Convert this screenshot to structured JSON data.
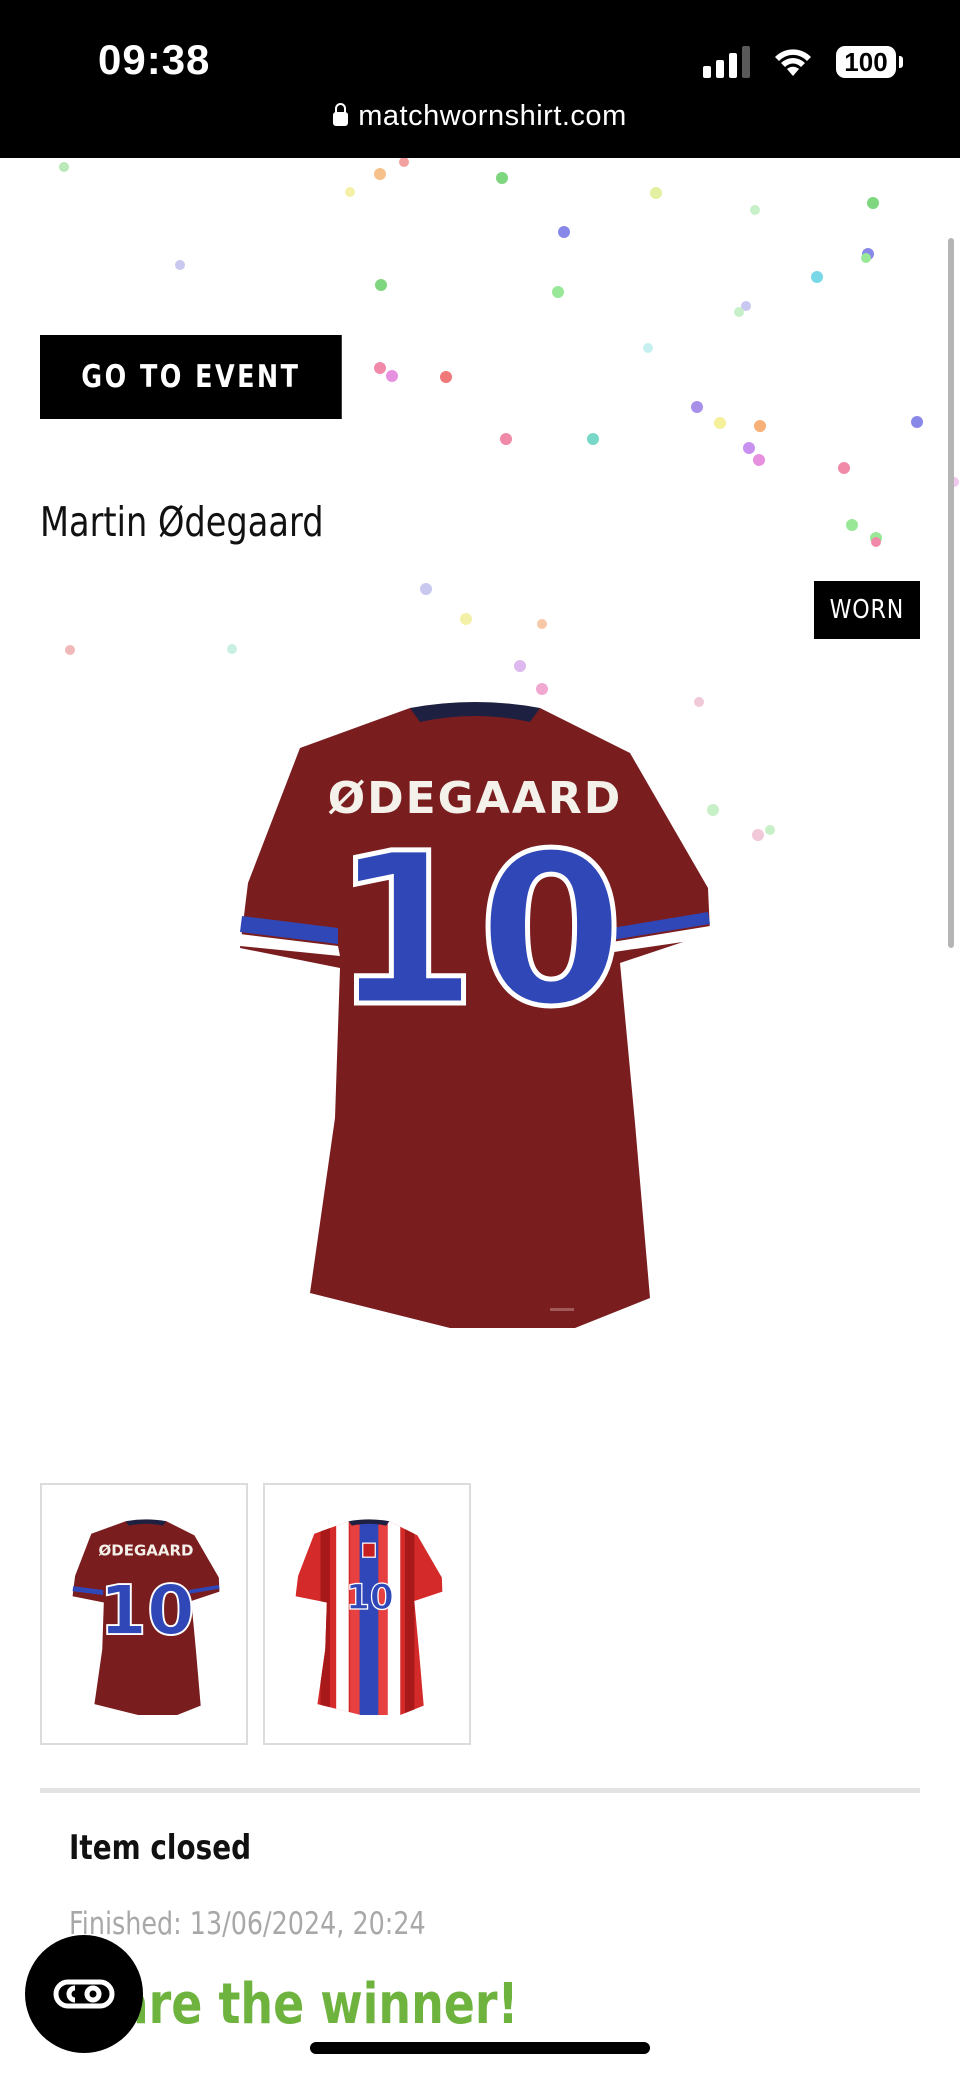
{
  "status_bar": {
    "time": "09:38",
    "battery": "100",
    "url": "matchwornshirt.com"
  },
  "event_button": {
    "label": "GO TO EVENT"
  },
  "item": {
    "player_name": "Martin Ødegaard",
    "badge": "WORN",
    "shirt_name": "ØDEGAARD",
    "shirt_number": "10",
    "shirt_color": "#7a1d1f",
    "number_color": "#3047b8"
  },
  "thumbnails": [
    {
      "label": "back-view"
    },
    {
      "label": "front-view"
    }
  ],
  "status": {
    "title": "Item closed",
    "finished": "Finished: 13/06/2024, 20:24",
    "winner_text": "u are the winner!"
  },
  "colors": {
    "accent_green": "#6fb33f",
    "black": "#000000"
  }
}
